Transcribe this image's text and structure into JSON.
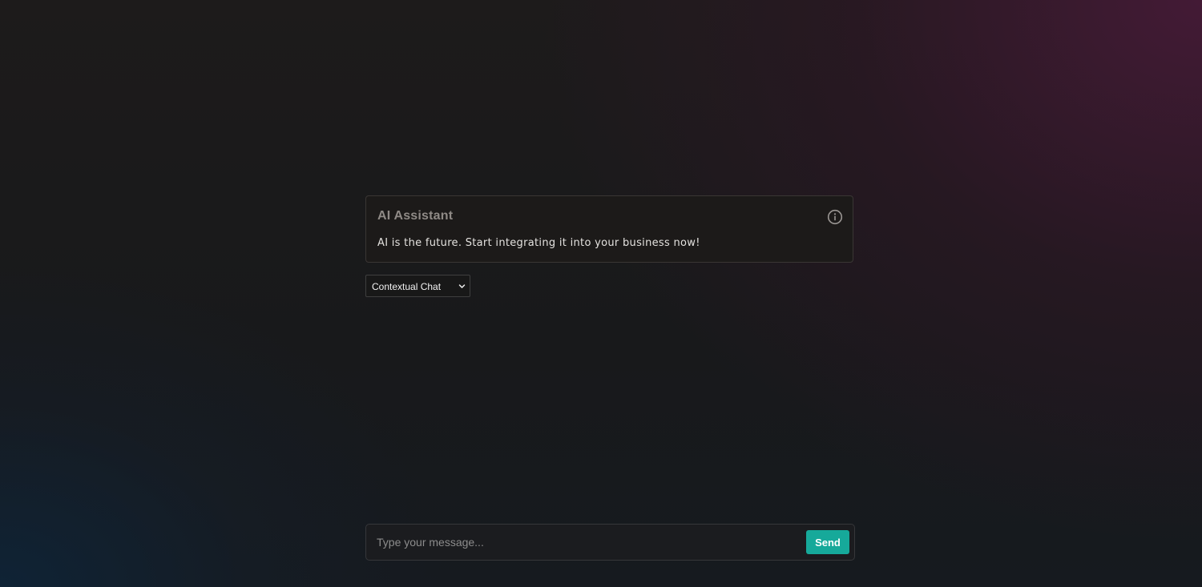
{
  "assistant_card": {
    "title": "AI Assistant",
    "description": "AI is the future. Start integrating it into your business now!",
    "info_icon": "info-circle-icon"
  },
  "mode_select": {
    "selected": "Contextual Chat",
    "chevron_icon": "chevron-down-icon"
  },
  "composer": {
    "placeholder": "Type your message...",
    "value": "",
    "send_label": "Send"
  },
  "colors": {
    "accent": "#16a99a",
    "background": "#18191b",
    "gradient_top_right": "#4a1a3a",
    "gradient_bottom_left": "#0e2438"
  }
}
